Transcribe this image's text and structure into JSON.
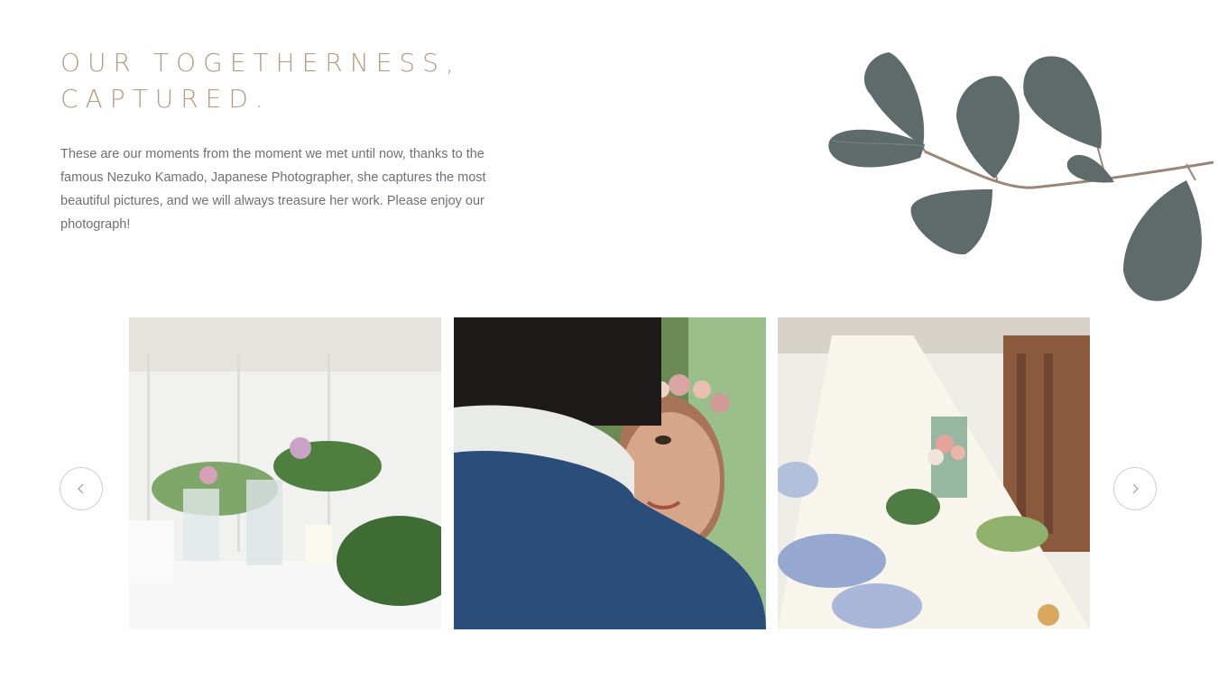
{
  "section": {
    "title_line1": "OUR TOGETHERNESS,",
    "title_line2": "CAPTURED.",
    "description": "These are our moments from the moment we met until now, thanks to the famous Nezuko Kamado, Japanese Photographer, she captures the most beautiful pictures, and we will always treasure her work. Please enjoy our photograph!"
  },
  "gallery": {
    "prev_icon": "chevron-left-icon",
    "next_icon": "chevron-right-icon",
    "photos": [
      {
        "subject": "wedding-table-glasses-candle"
      },
      {
        "subject": "bride-with-flower-crown"
      },
      {
        "subject": "long-banquet-table-flowers"
      }
    ]
  },
  "colors": {
    "title": "#b99a82",
    "text": "#6f6f76",
    "leaf": "#5f6b6a",
    "arrow_border": "#cfcfcf"
  }
}
